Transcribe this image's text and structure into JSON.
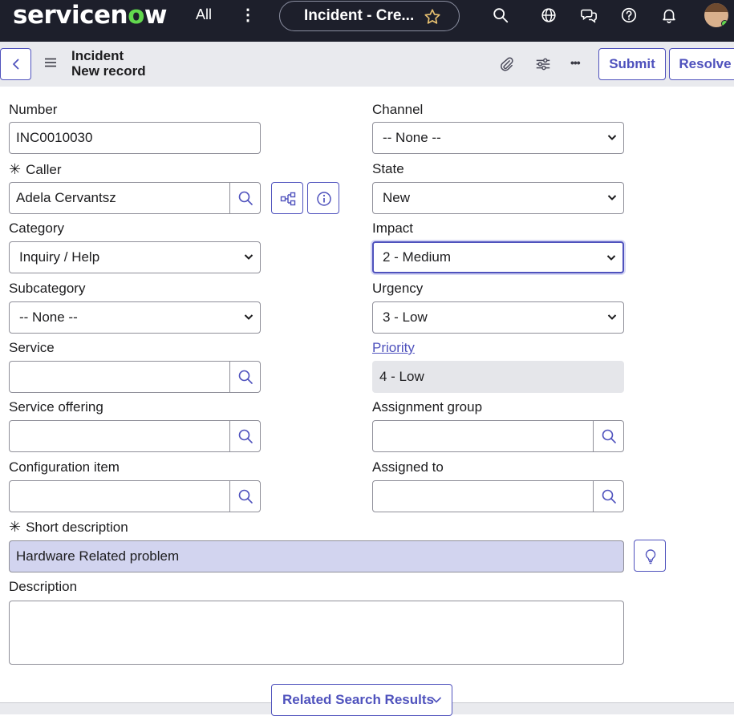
{
  "topbar": {
    "logo_main": "servicen",
    "logo_o": "o",
    "logo_end": "w",
    "all_label": "All",
    "more_label": "⋮",
    "tab_title": "Incident - Cre..."
  },
  "header": {
    "title": "Incident",
    "subtitle": "New record",
    "submit_label": "Submit",
    "resolve_label": "Resolve",
    "more_label": "•••"
  },
  "form": {
    "number": {
      "label": "Number",
      "value": "INC0010030"
    },
    "caller": {
      "label": "Caller",
      "value": "Adela Cervantsz",
      "required_mark": "✳"
    },
    "category": {
      "label": "Category",
      "value": "Inquiry / Help"
    },
    "subcategory": {
      "label": "Subcategory",
      "value": "-- None --"
    },
    "service": {
      "label": "Service",
      "value": ""
    },
    "service_offering": {
      "label": "Service offering",
      "value": ""
    },
    "configuration_item": {
      "label": "Configuration item",
      "value": ""
    },
    "channel": {
      "label": "Channel",
      "value": "-- None --"
    },
    "state": {
      "label": "State",
      "value": "New"
    },
    "impact": {
      "label": "Impact",
      "value": "2 - Medium"
    },
    "urgency": {
      "label": "Urgency",
      "value": "3 - Low"
    },
    "priority": {
      "label": "Priority",
      "value": "4 - Low"
    },
    "assignment_group": {
      "label": "Assignment group",
      "value": ""
    },
    "assigned_to": {
      "label": "Assigned to",
      "value": ""
    },
    "short_description": {
      "label": "Short description",
      "value": "Hardware Related problem",
      "required_mark": "✳"
    },
    "description": {
      "label": "Description",
      "value": ""
    }
  },
  "footer": {
    "related_search_label": "Related Search Results"
  },
  "colors": {
    "topbar_bg": "#1d1f2b",
    "accent": "#4f52bd",
    "logo_green": "#62d84e",
    "highlight_field": "#d2d4ef"
  },
  "icons": [
    "star-icon",
    "search-icon",
    "globe-icon",
    "chat-icon",
    "help-icon",
    "bell-icon",
    "back-icon",
    "menu-icon",
    "paperclip-icon",
    "settings-sliders-icon",
    "hierarchy-icon",
    "info-icon",
    "lightbulb-icon",
    "chevron-down-icon"
  ]
}
